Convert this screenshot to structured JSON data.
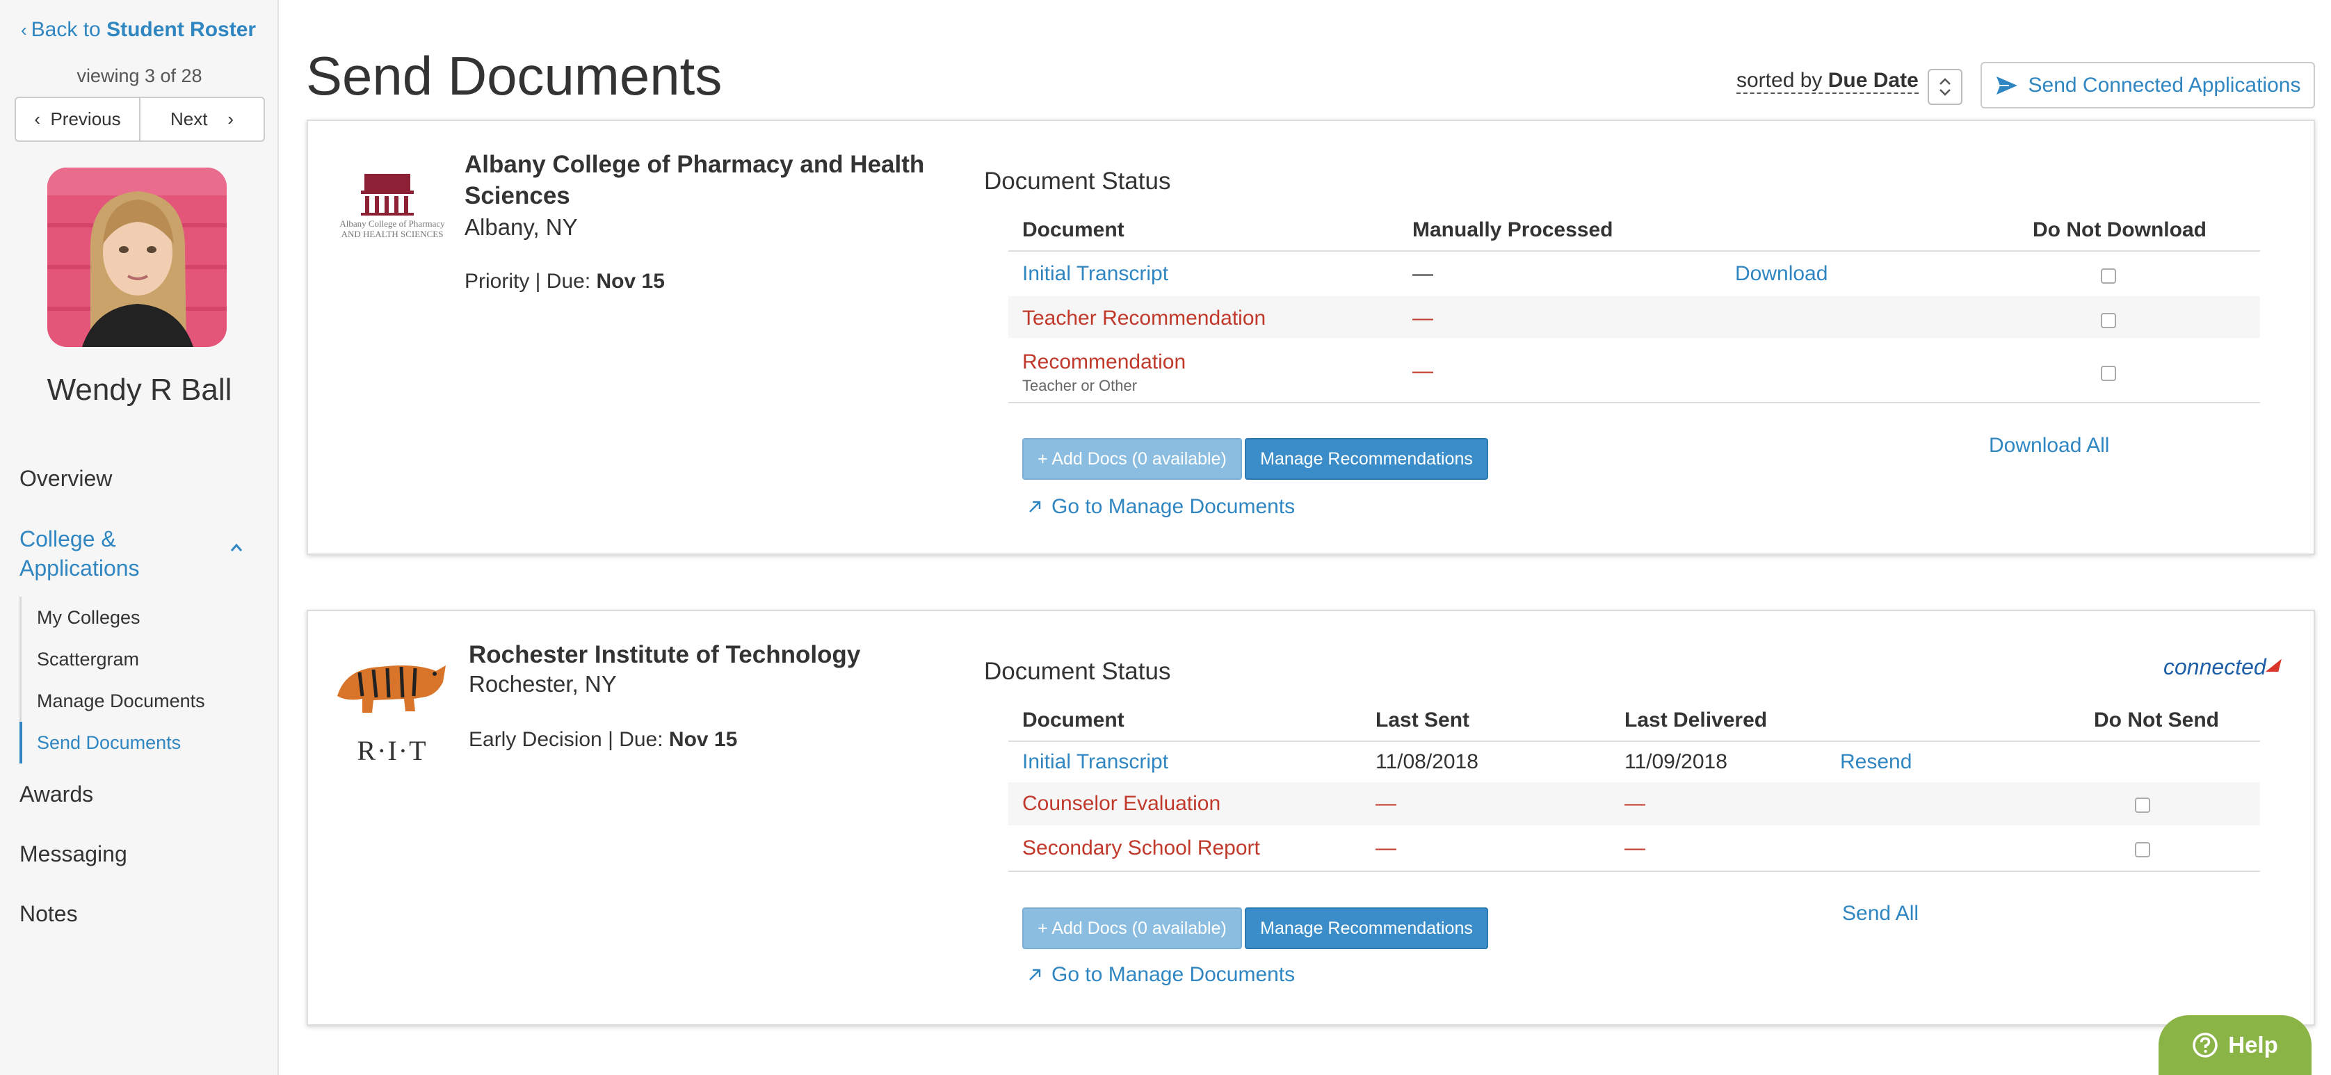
{
  "sidebar": {
    "back_prefix": "Back to ",
    "back_target": "Student Roster",
    "viewing": "viewing 3 of 28",
    "prev_label": "Previous",
    "next_label": "Next",
    "student_name": "Wendy R Ball",
    "nav": {
      "overview": "Overview",
      "college_line1": "College &",
      "college_line2": "Applications",
      "sub": [
        "My Colleges",
        "Scattergram",
        "Manage Documents",
        "Send Documents"
      ],
      "awards": "Awards",
      "messaging": "Messaging",
      "notes": "Notes"
    }
  },
  "header": {
    "title": "Send Documents",
    "sorted_by_prefix": "sorted by ",
    "sorted_by_value": "Due Date",
    "send_connected": "Send Connected Applications"
  },
  "cards": [
    {
      "name": "Albany College of Pharmacy and Health Sciences",
      "name_line1": "Albany College of Pharmacy and Health",
      "name_line2": "Sciences",
      "location": "Albany, NY",
      "due_prefix": "Priority | Due: ",
      "due_date": "Nov 15",
      "logo_caption": "Albany College of Pharmacy AND HEALTH SCIENCES",
      "status_title": "Document Status",
      "columns": [
        "Document",
        "Manually Processed",
        "Do Not Download"
      ],
      "rows": [
        {
          "doc": "Initial Transcript",
          "status": "—",
          "action": "Download"
        },
        {
          "doc": "Teacher Recommendation",
          "status": "—"
        },
        {
          "doc": "Recommendation",
          "sub": "Teacher or Other",
          "status": "—"
        }
      ],
      "add_docs": "+ Add Docs (0 available)",
      "manage_recs": "Manage Recommendations",
      "bulk_action": "Download All",
      "goto": "Go to Manage Documents"
    },
    {
      "name": "Rochester Institute of Technology",
      "location": "Rochester, NY",
      "due_prefix": "Early Decision | Due: ",
      "due_date": "Nov 15",
      "logo_text": "R·I·T",
      "connected_logo": "connected",
      "status_title": "Document Status",
      "columns": [
        "Document",
        "Last Sent",
        "Last Delivered",
        "Do Not Send"
      ],
      "rows": [
        {
          "doc": "Initial Transcript",
          "last_sent": "11/08/2018",
          "last_delivered": "11/09/2018",
          "action": "Resend"
        },
        {
          "doc": "Counselor Evaluation",
          "last_sent": "—",
          "last_delivered": "—"
        },
        {
          "doc": "Secondary School Report",
          "last_sent": "—",
          "last_delivered": "—"
        }
      ],
      "add_docs": "+ Add Docs (0 available)",
      "manage_recs": "Manage Recommendations",
      "bulk_action": "Send All",
      "goto": "Go to Manage Documents"
    }
  ],
  "help": "Help",
  "colors": {
    "link": "#2f86c1",
    "alert_red": "#c0392b",
    "help_green": "#8ab446",
    "button_dark": "#3a8dc8",
    "button_light": "#8bbde0"
  }
}
